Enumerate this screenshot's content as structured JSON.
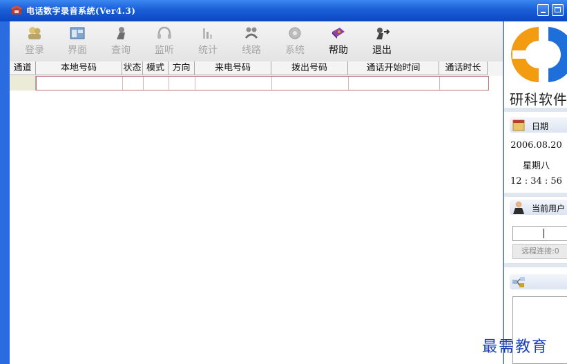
{
  "window": {
    "title": "电话数字录音系统(Ver4.3)",
    "app_icon": "phone-icon",
    "controls": [
      "minimize-icon",
      "maximize-icon"
    ]
  },
  "toolbar": {
    "items": [
      {
        "label": "登录",
        "icon": "login-icon",
        "enabled": false
      },
      {
        "label": "界面",
        "icon": "interface-icon",
        "enabled": false
      },
      {
        "label": "查询",
        "icon": "query-icon",
        "enabled": false
      },
      {
        "label": "监听",
        "icon": "headphones-icon",
        "enabled": false
      },
      {
        "label": "统计",
        "icon": "statistics-icon",
        "enabled": false
      },
      {
        "label": "线路",
        "icon": "lines-icon",
        "enabled": false
      },
      {
        "label": "系统",
        "icon": "system-icon",
        "enabled": false
      },
      {
        "label": "帮助",
        "icon": "help-book-icon",
        "enabled": true
      },
      {
        "label": "退出",
        "icon": "exit-icon",
        "enabled": true
      }
    ]
  },
  "grid": {
    "columns": [
      "通道",
      "本地号码",
      "状态",
      "模式",
      "方向",
      "来电号码",
      "拨出号码",
      "通话开始时间",
      "通话时长"
    ],
    "rows": [
      [
        "",
        "",
        "",
        "",
        "",
        "",
        "",
        "",
        ""
      ]
    ]
  },
  "side_panel": {
    "logo_text": "研科软件",
    "date_section": {
      "title": "日期",
      "icon": "calendar-icon"
    },
    "date": "2006.08.20",
    "weekday": "星期八",
    "time": "12 : 34 : 56",
    "user_section": {
      "title": "当前用户",
      "icon": "user-icon"
    },
    "current_user": "",
    "remote_label": "远程连接:0",
    "log_section": {
      "title": "",
      "icon": "network-icon"
    }
  },
  "watermark": "最需教育",
  "colors": {
    "title_bar": "#1a5fd6",
    "accent": "#3b86f0",
    "logo_orange": "#f39c12",
    "logo_blue": "#1e6fd9"
  }
}
